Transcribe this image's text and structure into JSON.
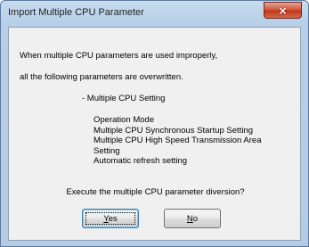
{
  "window": {
    "title": "Import Multiple CPU Parameter",
    "close_glyph": "×"
  },
  "message": {
    "line1": "When multiple CPU parameters are used improperly,",
    "line2": "all the following parameters are overwritten."
  },
  "section_title": "- Multiple CPU Setting",
  "items": [
    "Operation Mode",
    "Multiple CPU Synchronous Startup Setting",
    "Multiple CPU High Speed Transmission Area",
    "Setting",
    "Automatic refresh setting"
  ],
  "question": "Execute the multiple CPU parameter diversion?",
  "buttons": {
    "yes_label": "Yes",
    "no_label": "No"
  },
  "colors": {
    "title_bar": "#b8cfe7",
    "close_button": "#c0391b",
    "client_bg": "#f0f0f0"
  }
}
